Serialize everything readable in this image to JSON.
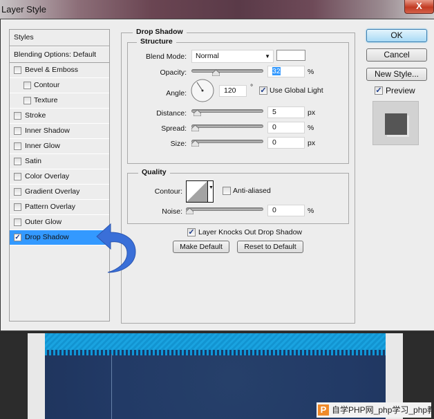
{
  "window": {
    "title": "Layer Style",
    "close_label": "X"
  },
  "styles_list": {
    "header": "Styles",
    "blending": "Blending Options: Default",
    "items": [
      {
        "label": "Bevel & Emboss",
        "checked": false,
        "sub": false
      },
      {
        "label": "Contour",
        "checked": false,
        "sub": true
      },
      {
        "label": "Texture",
        "checked": false,
        "sub": true
      },
      {
        "label": "Stroke",
        "checked": false,
        "sub": false
      },
      {
        "label": "Inner Shadow",
        "checked": false,
        "sub": false
      },
      {
        "label": "Inner Glow",
        "checked": false,
        "sub": false
      },
      {
        "label": "Satin",
        "checked": false,
        "sub": false
      },
      {
        "label": "Color Overlay",
        "checked": false,
        "sub": false
      },
      {
        "label": "Gradient Overlay",
        "checked": false,
        "sub": false
      },
      {
        "label": "Pattern Overlay",
        "checked": false,
        "sub": false
      },
      {
        "label": "Outer Glow",
        "checked": false,
        "sub": false
      },
      {
        "label": "Drop Shadow",
        "checked": true,
        "sub": false,
        "selected": true
      }
    ],
    "check_glyph": "✓"
  },
  "panel": {
    "title": "Drop Shadow",
    "structure": {
      "title": "Structure",
      "blend_mode_label": "Blend Mode:",
      "blend_mode_value": "Normal",
      "shadow_color": "#ffffff",
      "opacity_label": "Opacity:",
      "opacity_value": "32",
      "opacity_unit": "%",
      "opacity_slider_percent": 32,
      "angle_label": "Angle:",
      "angle_value": "120",
      "angle_unit": "°",
      "use_global_light_label": "Use Global Light",
      "use_global_light": true,
      "distance_label": "Distance:",
      "distance_value": "5",
      "distance_unit": "px",
      "spread_label": "Spread:",
      "spread_value": "0",
      "spread_unit": "%",
      "size_label": "Size:",
      "size_value": "0",
      "size_unit": "px"
    },
    "quality": {
      "title": "Quality",
      "contour_label": "Contour:",
      "anti_aliased_label": "Anti-aliased",
      "anti_aliased": false,
      "noise_label": "Noise:",
      "noise_value": "0",
      "noise_unit": "%"
    },
    "knockout_label": "Layer Knocks Out Drop Shadow",
    "knockout": true,
    "make_default": "Make Default",
    "reset_default": "Reset to Default"
  },
  "actions": {
    "ok": "OK",
    "cancel": "Cancel",
    "new_style": "New Style...",
    "preview_label": "Preview",
    "preview": true
  },
  "watermark": {
    "logo": "P",
    "text": "自学PHP网_php学习_php教"
  },
  "colors": {
    "selection": "#3399ff",
    "arrow": "#3a6fd8"
  }
}
